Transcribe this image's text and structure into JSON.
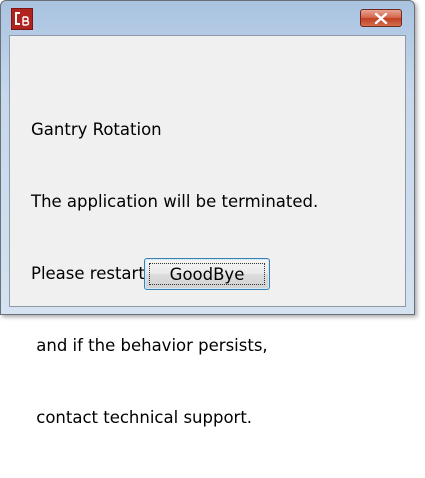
{
  "dialog": {
    "app_icon": "cb-logo-icon",
    "close_icon": "close-icon",
    "message_lines": [
      "Gantry Rotation",
      "The application will be terminated.",
      "Please restart the system,",
      " and if the behavior persists,",
      " contact technical support."
    ],
    "button_label": "GoodBye"
  },
  "colors": {
    "app_icon_bg": "#b0231f",
    "close_button": "#c23e22",
    "titlebar": "#a9c3e0",
    "client_bg": "#f0f0f0",
    "button_border": "#3c7fb1"
  }
}
